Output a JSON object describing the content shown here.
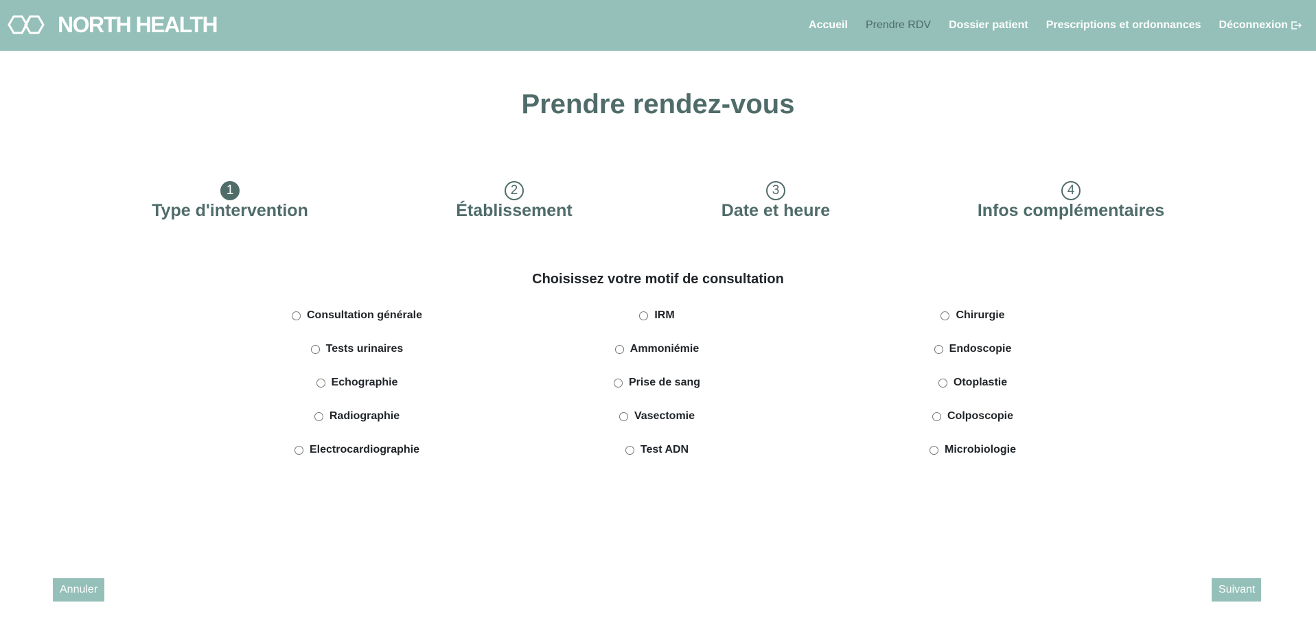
{
  "header": {
    "brand": "NORTH HEALTH",
    "nav": [
      {
        "label": "Accueil"
      },
      {
        "label": "Prendre RDV"
      },
      {
        "label": "Dossier patient"
      },
      {
        "label": "Prescriptions et ordonnances"
      },
      {
        "label": "Déconnexion"
      }
    ]
  },
  "main": {
    "title": "Prendre rendez-vous",
    "steps": [
      {
        "number": "1",
        "label": "Type d'intervention"
      },
      {
        "number": "2",
        "label": "Établissement"
      },
      {
        "number": "3",
        "label": "Date et heure"
      },
      {
        "number": "4",
        "label": "Infos complémentaires"
      }
    ],
    "question": "Choisissez votre motif de consultation",
    "options": [
      [
        "Consultation générale",
        "IRM",
        "Chirurgie"
      ],
      [
        "Tests urinaires",
        "Ammoniémie",
        "Endoscopie"
      ],
      [
        "Echographie",
        "Prise de sang",
        "Otoplastie"
      ],
      [
        "Radiographie",
        "Vasectomie",
        "Colposcopie"
      ],
      [
        "Electrocardiographie",
        "Test ADN",
        "Microbiologie"
      ]
    ]
  },
  "footer": {
    "cancel_label": "Annuler",
    "next_label": "Suivant"
  },
  "colors": {
    "navbar": "#94c0b9",
    "accent_dark": "#4f6c69",
    "button": "#94c0b9"
  },
  "icons": {
    "logo": "north-health-logo-icon",
    "logout": "logout-arrow-icon"
  }
}
